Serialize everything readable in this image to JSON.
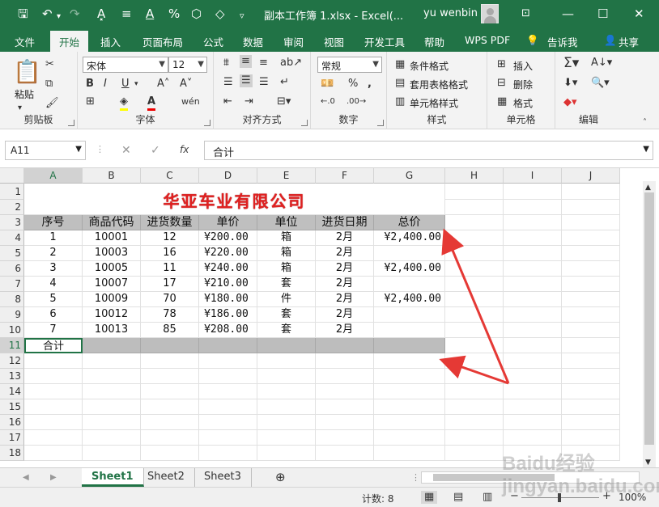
{
  "window": {
    "title": "副本工作簿 1.xlsx - Excel(...",
    "user": "yu wenbin"
  },
  "tabs": [
    "文件",
    "开始",
    "插入",
    "页面布局",
    "公式",
    "数据",
    "审阅",
    "视图",
    "开发工具",
    "帮助",
    "WPS PDF",
    "告诉我",
    "共享"
  ],
  "ribbon": {
    "clipboard": {
      "label": "剪贴板",
      "paste": "粘贴"
    },
    "font": {
      "label": "字体",
      "name": "宋体",
      "size": "12"
    },
    "alignment": {
      "label": "对齐方式"
    },
    "number": {
      "label": "数字",
      "format": "常规"
    },
    "styles": {
      "label": "样式",
      "cond": "条件格式",
      "table": "套用表格格式",
      "cell": "单元格样式"
    },
    "cells": {
      "label": "单元格",
      "insert": "插入",
      "delete": "删除",
      "format": "格式"
    },
    "editing": {
      "label": "编辑"
    }
  },
  "formula_bar": {
    "name_box": "A11",
    "content": "合计",
    "fx": "fx"
  },
  "columns": [
    "A",
    "B",
    "C",
    "D",
    "E",
    "F",
    "G",
    "H",
    "I",
    "J"
  ],
  "rows": [
    "1",
    "2",
    "3",
    "4",
    "5",
    "6",
    "7",
    "8",
    "9",
    "10",
    "11",
    "12",
    "13",
    "14",
    "15",
    "16",
    "17",
    "18"
  ],
  "sheet": {
    "title": "华亚车业有限公司",
    "headers": [
      "序号",
      "商品代码",
      "进货数量",
      "单价",
      "单位",
      "进货日期",
      "总价"
    ],
    "data": [
      [
        "1",
        "10001",
        "12",
        "¥200.00",
        "箱",
        "2月",
        "¥2,400.00"
      ],
      [
        "2",
        "10003",
        "16",
        "¥220.00",
        "箱",
        "2月",
        ""
      ],
      [
        "3",
        "10005",
        "11",
        "¥240.00",
        "箱",
        "2月",
        "¥2,400.00"
      ],
      [
        "4",
        "10007",
        "17",
        "¥210.00",
        "套",
        "2月",
        ""
      ],
      [
        "5",
        "10009",
        "70",
        "¥180.00",
        "件",
        "2月",
        "¥2,400.00"
      ],
      [
        "6",
        "10012",
        "78",
        "¥186.00",
        "套",
        "2月",
        ""
      ],
      [
        "7",
        "10013",
        "85",
        "¥208.00",
        "套",
        "2月",
        ""
      ]
    ],
    "total_label": "合计"
  },
  "sheet_tabs": [
    "Sheet1",
    "Sheet2",
    "Sheet3"
  ],
  "status": {
    "count": "计数: 8",
    "zoom": "100%"
  },
  "watermark": "Baidu经验 jingyan.baidu.com"
}
